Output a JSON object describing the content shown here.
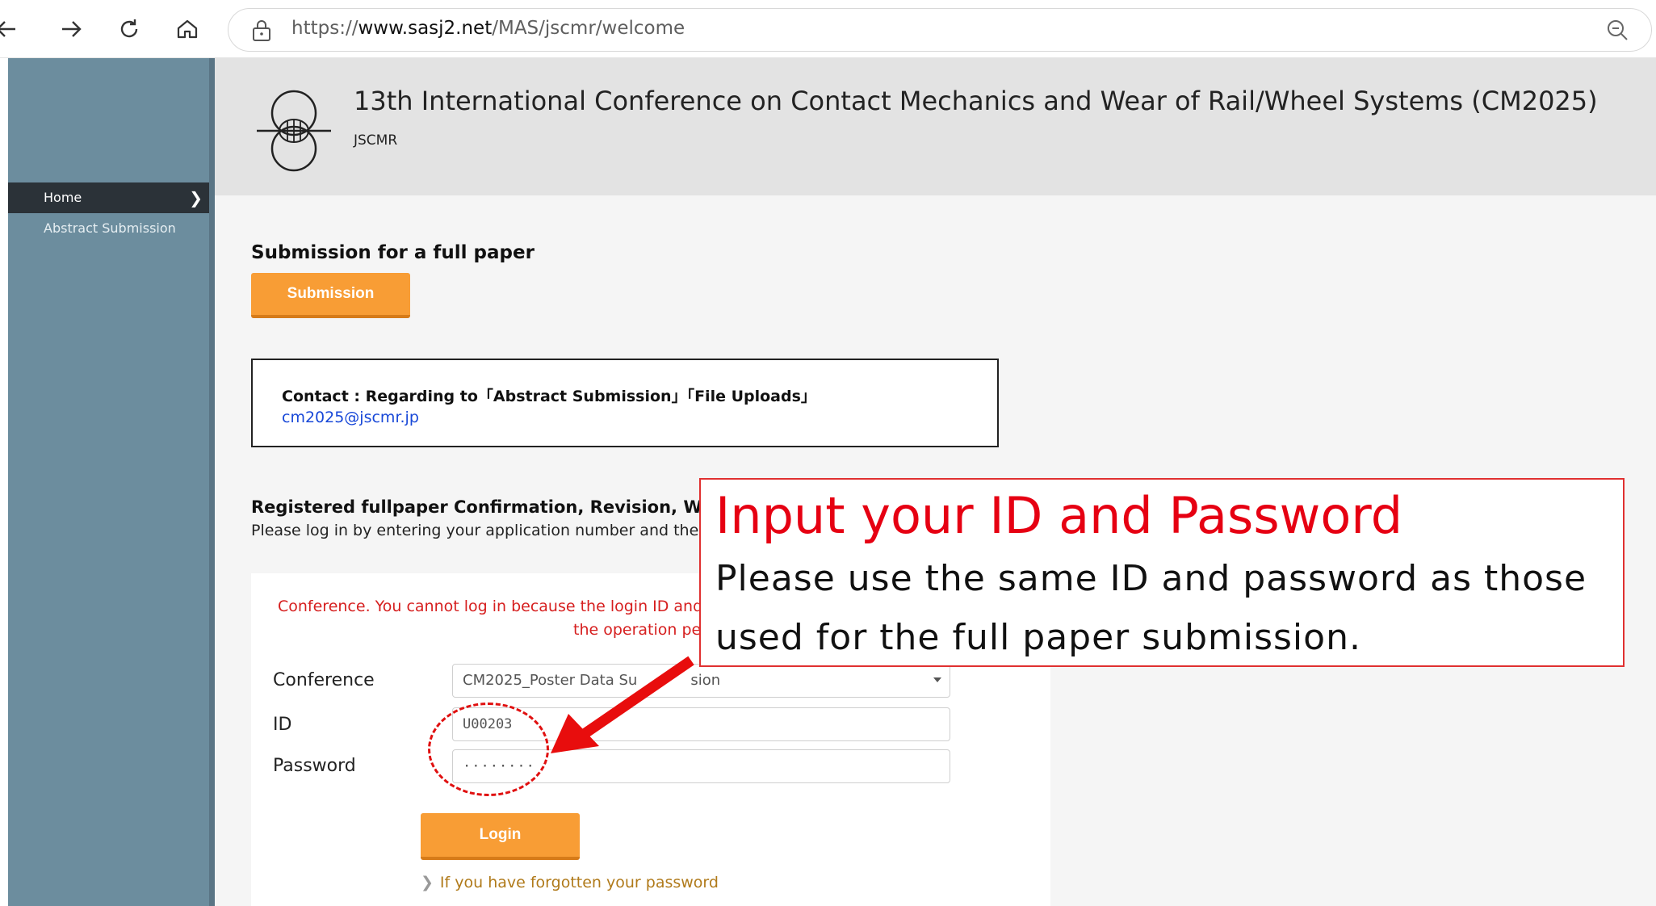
{
  "browser": {
    "url_prefix": "https://",
    "url_domain": "www.sasj2.net",
    "url_path": "/MAS/jscmr/welcome"
  },
  "sidebar": {
    "items": [
      {
        "label": "Home",
        "active": true,
        "chevron": "❯"
      },
      {
        "label": "Abstract Submission",
        "active": false
      }
    ]
  },
  "header": {
    "title": "13th International Conference on Contact Mechanics and Wear of Rail/Wheel Systems (CM2025)",
    "org": "JSCMR"
  },
  "main": {
    "full_paper_heading": "Submission for a full paper",
    "submission_button": "Submission",
    "contact_label": "Contact : Regarding to「Abstract Submission」「File Uploads」",
    "contact_email": "cm2025@jscmr.jp",
    "registered_heading": "Registered fullpaper Confirmation, Revision, With",
    "registered_desc": "Please log in by entering your application number and the pas",
    "login": {
      "error_line1": "Conference. You cannot log in because the login ID and pa",
      "error_line2": "the operation per",
      "conference_label": "Conference",
      "conference_value": "CM2025_Poster Data Su",
      "conference_value_tail": "sion",
      "id_label": "ID",
      "id_value": "U00203",
      "password_label": "Password",
      "password_value": "········",
      "login_button": "Login",
      "forgot_chevron": "❯",
      "forgot_link": "If you have forgotten your password"
    }
  },
  "annotation": {
    "title": "Input your ID and Password",
    "body": "Please use the same ID and password as those used for the full paper submission.",
    "title_color": "#e60012",
    "border_color": "#e03030",
    "arrow_color": "#e80d0d"
  },
  "colors": {
    "sidebar": "#6c8d9e",
    "sidebar_active": "#2b3238",
    "header_band": "#e3e3e3",
    "orange_button": "#f89d35",
    "link_blue": "#1848d8",
    "error_red": "#d61f1f"
  },
  "icons": {
    "back": "arrow-left-icon",
    "forward": "arrow-right-icon",
    "reload": "reload-icon",
    "home": "home-icon",
    "site_info": "lock-icon",
    "zoom": "zoom-out-icon",
    "logo": "rail-wheel-logo-icon"
  }
}
